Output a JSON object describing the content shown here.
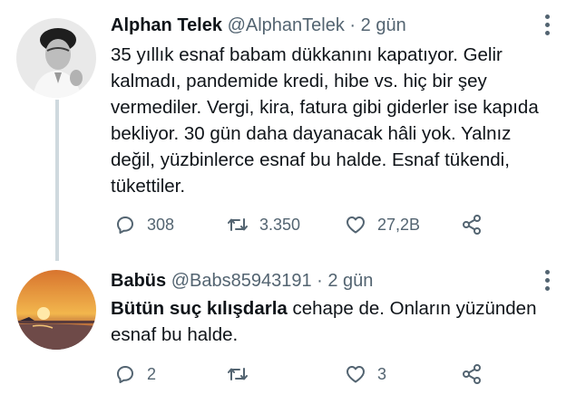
{
  "tweets": [
    {
      "name": "Alphan Telek",
      "handle": "@AlphanTelek",
      "separator": "·",
      "time": "2 gün",
      "text": "35 yıllık esnaf babam dükkanını kapatıyor. Gelir kalmadı, pandemide kredi, hibe vs. hiç bir şey vermediler. Vergi, kira, fatura gibi giderler ise kapıda bekliyor. 30 gün daha dayanacak hâli yok. Yalnız değil, yüzbinlerce esnaf bu halde. Esnaf tükendi, tükettiler.",
      "replies": "308",
      "retweets": "3.350",
      "likes": "27,2B"
    },
    {
      "name": "Babüs",
      "handle": "@Babs85943191",
      "separator": "·",
      "time": "2 gün",
      "text_bold": "Bütün suç kılışdarla",
      "text_rest": " cehape de. Onların yüzünden esnaf bu halde.",
      "replies": "2",
      "retweets": "",
      "likes": "3"
    }
  ],
  "icons": [
    "reply-icon",
    "retweet-icon",
    "like-icon",
    "share-icon",
    "more-icon"
  ]
}
